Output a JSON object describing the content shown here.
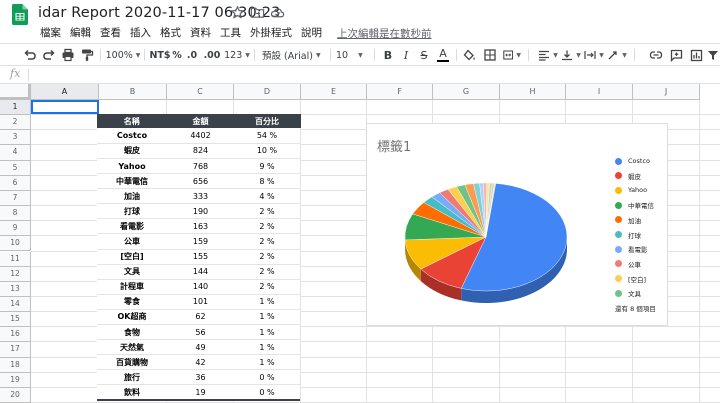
{
  "document": {
    "title": "idar Report 2020-11-17 06:30:23"
  },
  "menu": {
    "items": [
      "檔案",
      "編輯",
      "查看",
      "插入",
      "格式",
      "資料",
      "工具",
      "外掛程式",
      "說明"
    ],
    "last_edit": "上次編輯是在數秒前"
  },
  "toolbar": {
    "zoom": "100%",
    "currency": "NT$",
    "percent": "%",
    "decimal_decrease": ".0",
    "decimal_increase": ".00",
    "more_formats": "123",
    "font": "預設 (Arial)",
    "font_size": "10",
    "bold": "B",
    "italic": "I",
    "strike": "S",
    "text_color": "A"
  },
  "formula_bar": {
    "fx": "fx"
  },
  "grid": {
    "columns": [
      "A",
      "B",
      "C",
      "D",
      "E",
      "F",
      "G",
      "H",
      "I",
      "J"
    ],
    "rows": [
      "1",
      "2",
      "3",
      "4",
      "5",
      "6",
      "7",
      "8",
      "9",
      "10",
      "11",
      "12",
      "13",
      "14",
      "15",
      "16",
      "17",
      "18",
      "19",
      "20"
    ]
  },
  "table": {
    "headers": [
      "名稱",
      "金額",
      "百分比"
    ],
    "rows": [
      [
        "Costco",
        "4402",
        "54 %"
      ],
      [
        "蝦皮",
        "824",
        "10 %"
      ],
      [
        "Yahoo",
        "768",
        "9 %"
      ],
      [
        "中華電信",
        "656",
        "8 %"
      ],
      [
        "加油",
        "333",
        "4 %"
      ],
      [
        "打球",
        "190",
        "2 %"
      ],
      [
        "看電影",
        "163",
        "2 %"
      ],
      [
        "公車",
        "159",
        "2 %"
      ],
      [
        "[空白]",
        "155",
        "2 %"
      ],
      [
        "文具",
        "144",
        "2 %"
      ],
      [
        "計程車",
        "140",
        "2 %"
      ],
      [
        "零食",
        "101",
        "1 %"
      ],
      [
        "OK超商",
        "62",
        "1 %"
      ],
      [
        "食物",
        "56",
        "1 %"
      ],
      [
        "天然氣",
        "49",
        "1 %"
      ],
      [
        "百貨購物",
        "42",
        "1 %"
      ],
      [
        "旅行",
        "36",
        "0 %"
      ],
      [
        "飲料",
        "19",
        "0 %"
      ]
    ]
  },
  "chart_data": {
    "type": "pie",
    "title": "標籤1",
    "three_d": true,
    "legend_position": "right",
    "categories": [
      "Costco",
      "蝦皮",
      "Yahoo",
      "中華電信",
      "加油",
      "打球",
      "看電影",
      "公車",
      "[空白]",
      "文具",
      "計程車",
      "零食",
      "OK超商",
      "食物",
      "天然氣",
      "百貨購物",
      "旅行",
      "飲料"
    ],
    "values": [
      4402,
      824,
      768,
      656,
      333,
      190,
      163,
      159,
      155,
      144,
      140,
      101,
      62,
      56,
      49,
      42,
      36,
      19
    ],
    "colors": [
      "#4285f4",
      "#ea4335",
      "#fbbc04",
      "#34a853",
      "#ff6d01",
      "#46bdc6",
      "#7baaf7",
      "#f07b72",
      "#fcd04f",
      "#71c287",
      "#ff994d",
      "#7ed1d7",
      "#b3cefb",
      "#f7b4ae",
      "#fde49b",
      "#aedcba",
      "#ffc599",
      "#b6e5e9"
    ],
    "legend_shown": [
      "Costco",
      "蝦皮",
      "Yahoo",
      "中華電信",
      "加油",
      "打球",
      "看電影",
      "公車",
      "[空白]",
      "文具"
    ],
    "legend_more": "還有 8 個項目"
  }
}
